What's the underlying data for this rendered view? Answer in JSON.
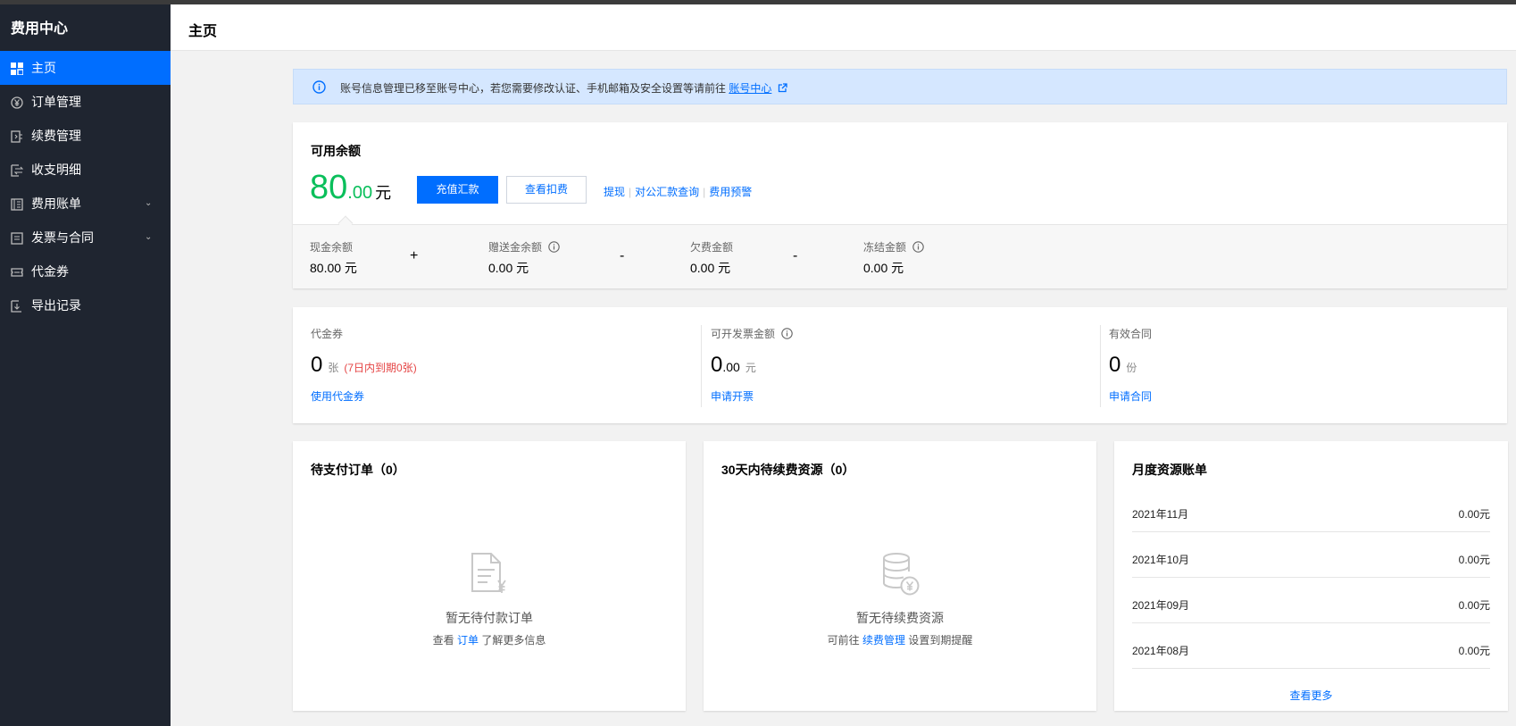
{
  "sidebar": {
    "title": "费用中心",
    "items": [
      {
        "label": "主页",
        "icon": "dashboard-icon",
        "active": true
      },
      {
        "label": "订单管理",
        "icon": "yen-circle-icon"
      },
      {
        "label": "续费管理",
        "icon": "renew-doc-icon"
      },
      {
        "label": "收支明细",
        "icon": "transfer-icon"
      },
      {
        "label": "费用账单",
        "icon": "bill-book-icon",
        "expandable": true
      },
      {
        "label": "发票与合同",
        "icon": "invoice-icon",
        "expandable": true
      },
      {
        "label": "代金券",
        "icon": "ticket-icon"
      },
      {
        "label": "导出记录",
        "icon": "export-icon"
      }
    ],
    "chevron": "⌄"
  },
  "header": {
    "title": "主页"
  },
  "notice": {
    "text": "账号信息管理已移至账号中心，若您需要修改认证、手机邮箱及安全设置等请前往",
    "link": "账号中心"
  },
  "balance": {
    "title": "可用余额",
    "amount_int": "80",
    "amount_dec": ".00",
    "unit": "元",
    "recharge_button": "充值汇款",
    "deduction_button": "查看扣费",
    "links": [
      "提现",
      "对公汇款查询",
      "费用预警"
    ],
    "details": [
      {
        "label": "现金余额",
        "value": "80.00 元"
      },
      {
        "label": "赠送金余额",
        "value": "0.00 元"
      },
      {
        "label": "欠费金额",
        "value": "0.00 元"
      },
      {
        "label": "冻结金额",
        "value": "0.00 元"
      }
    ],
    "operators": [
      "+",
      "-",
      "-"
    ]
  },
  "summary": {
    "voucher": {
      "label": "代金券",
      "value": "0",
      "unit": "张",
      "warn": "(7日内到期0张)",
      "link": "使用代金券"
    },
    "invoice": {
      "label": "可开发票金额",
      "value_int": "0",
      "value_dec": ".00",
      "unit": "元",
      "link": "申请开票"
    },
    "contract": {
      "label": "有效合同",
      "value": "0",
      "unit": "份",
      "link": "申请合同"
    }
  },
  "pending_orders": {
    "title": "待支付订单（0）",
    "empty_text": "暂无待付款订单",
    "hint_before": "查看",
    "hint_link": "订单",
    "hint_after": "了解更多信息"
  },
  "renewals": {
    "title": "30天内待续费资源（0）",
    "empty_text": "暂无待续费资源",
    "hint_before": "可前往",
    "hint_link": "续费管理",
    "hint_after": "设置到期提醒"
  },
  "monthly_bills": {
    "title": "月度资源账单",
    "rows": [
      {
        "month": "2021年11月",
        "amount": "0.00元"
      },
      {
        "month": "2021年10月",
        "amount": "0.00元"
      },
      {
        "month": "2021年09月",
        "amount": "0.00元"
      },
      {
        "month": "2021年08月",
        "amount": "0.00元"
      }
    ],
    "more": "查看更多"
  },
  "colors": {
    "accent": "#006eff",
    "sidebar_bg": "#1f2530",
    "balance_green": "#0abf5b",
    "warning_red": "#e54545"
  }
}
